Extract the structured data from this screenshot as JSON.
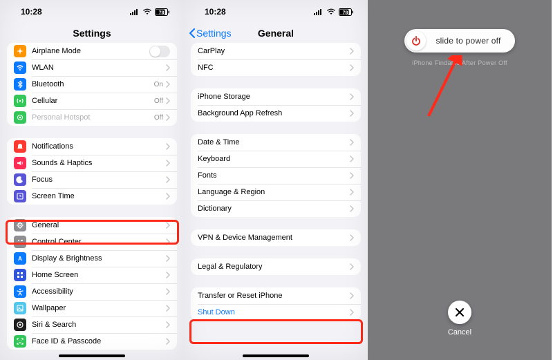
{
  "status": {
    "time": "10:28",
    "battery": "78"
  },
  "p1": {
    "title": "Settings",
    "g1": [
      {
        "label": "Airplane Mode",
        "iconName": "airplane-icon",
        "color": "#ff9500",
        "type": "toggle"
      },
      {
        "label": "WLAN",
        "iconName": "wifi-icon",
        "color": "#0a7aff",
        "type": "chev"
      },
      {
        "label": "Bluetooth",
        "iconName": "bluetooth-icon",
        "color": "#0a7aff",
        "type": "chev",
        "value": "On"
      },
      {
        "label": "Cellular",
        "iconName": "cellular-icon",
        "color": "#34c759",
        "type": "chev",
        "value": "Off"
      },
      {
        "label": "Personal Hotspot",
        "iconName": "hotspot-icon",
        "color": "#34c759",
        "type": "chev",
        "value": "Off",
        "dim": true
      }
    ],
    "g2": [
      {
        "label": "Notifications",
        "iconName": "notifications-icon",
        "color": "#ff3b30"
      },
      {
        "label": "Sounds & Haptics",
        "iconName": "sounds-icon",
        "color": "#ff2d55"
      },
      {
        "label": "Focus",
        "iconName": "focus-icon",
        "color": "#5856d6"
      },
      {
        "label": "Screen Time",
        "iconName": "screentime-icon",
        "color": "#5856d6"
      }
    ],
    "g3": [
      {
        "label": "General",
        "iconName": "general-icon",
        "color": "#8e8e93"
      },
      {
        "label": "Control Center",
        "iconName": "control-center-icon",
        "color": "#8e8e93"
      },
      {
        "label": "Display & Brightness",
        "iconName": "display-icon",
        "color": "#0a7aff"
      },
      {
        "label": "Home Screen",
        "iconName": "home-screen-icon",
        "color": "#3355dd"
      },
      {
        "label": "Accessibility",
        "iconName": "accessibility-icon",
        "color": "#0a7aff"
      },
      {
        "label": "Wallpaper",
        "iconName": "wallpaper-icon",
        "color": "#54c7ec"
      },
      {
        "label": "Siri & Search",
        "iconName": "siri-icon",
        "color": "#1e1e1e"
      },
      {
        "label": "Face ID & Passcode",
        "iconName": "faceid-icon",
        "color": "#34c759"
      }
    ]
  },
  "p2": {
    "backLabel": "Settings",
    "title": "General",
    "g1": [
      "CarPlay",
      "NFC"
    ],
    "g2": [
      "iPhone Storage",
      "Background App Refresh"
    ],
    "g3": [
      "Date & Time",
      "Keyboard",
      "Fonts",
      "Language & Region",
      "Dictionary"
    ],
    "g4": [
      "VPN & Device Management"
    ],
    "g5": [
      "Legal & Regulatory"
    ],
    "g6": [
      "Transfer or Reset iPhone",
      "Shut Down"
    ]
  },
  "p3": {
    "sliderLabel": "slide to power off",
    "cancelLabel": "Cancel"
  },
  "colors": {
    "arrow": "#ff2a1a",
    "power": "#d9302a"
  }
}
